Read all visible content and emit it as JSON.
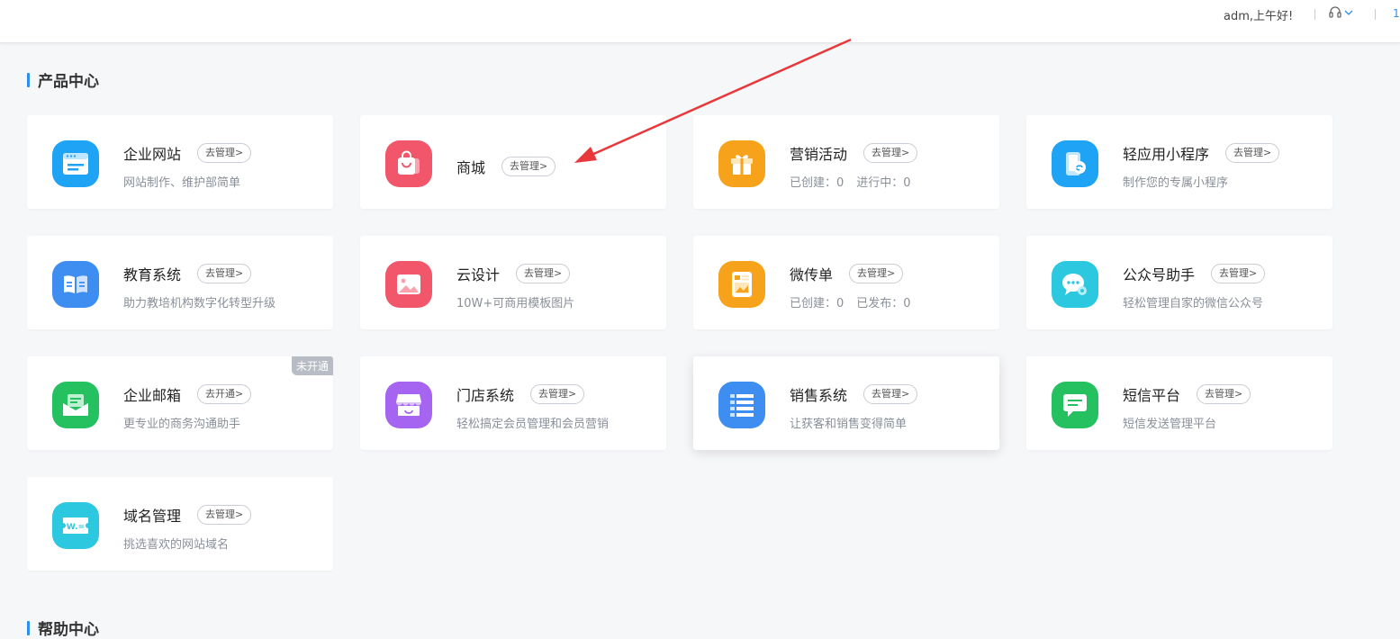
{
  "header": {
    "greeting": "adm,上午好!",
    "service_icon": "headset-icon",
    "dropdown_icon": "chevron-down-icon",
    "edge_text": "1"
  },
  "product_center": {
    "title": "产品中心",
    "manage_label": "去管理>",
    "cards": [
      {
        "name": "企业网站",
        "desc": "网站制作、维护部简单",
        "icon": "website-icon",
        "color": "#1fa3f5",
        "action": "去管理>"
      },
      {
        "name": "商城",
        "desc": "",
        "icon": "shopping-bag-icon",
        "color": "#f2566b",
        "action": "去管理>"
      },
      {
        "name": "营销活动",
        "stat1": "已创建：0",
        "stat2": "进行中：0",
        "icon": "gift-icon",
        "color": "#f7a21b",
        "action": "去管理>"
      },
      {
        "name": "轻应用小程序",
        "desc": "制作您的专属小程序",
        "icon": "mini-program-icon",
        "color": "#1fa3f5",
        "action": "去管理>"
      },
      {
        "name": "教育系统",
        "desc": "助力教培机构数字化转型升级",
        "icon": "book-icon",
        "color": "#3d8ef0",
        "action": "去管理>"
      },
      {
        "name": "云设计",
        "desc": "10W+可商用模板图片",
        "icon": "image-icon",
        "color": "#f2566b",
        "action": "去管理>"
      },
      {
        "name": "微传单",
        "stat1": "已创建：0",
        "stat2": "已发布：0",
        "icon": "flyer-icon",
        "color": "#f7a21b",
        "action": "去管理>"
      },
      {
        "name": "公众号助手",
        "desc": "轻松管理自家的微信公众号",
        "icon": "chat-gear-icon",
        "color": "#2cc8e0",
        "action": "去管理>"
      },
      {
        "name": "企业邮箱",
        "desc": "更专业的商务沟通助手",
        "icon": "mail-icon",
        "color": "#25c160",
        "action": "去开通>",
        "badge": "未开通"
      },
      {
        "name": "门店系统",
        "desc": "轻松搞定会员管理和会员营销",
        "icon": "store-icon",
        "color": "#a565f0",
        "action": "去管理>"
      },
      {
        "name": "销售系统",
        "desc": "让获客和销售变得简单",
        "icon": "list-icon",
        "color": "#3d8ef0",
        "action": "去管理>"
      },
      {
        "name": "短信平台",
        "desc": "短信发送管理平台",
        "icon": "sms-icon",
        "color": "#25c160",
        "action": "去管理>"
      },
      {
        "name": "域名管理",
        "desc": "挑选喜欢的网站域名",
        "icon": "domain-icon",
        "color": "#2cc8e0",
        "action": "去管理>"
      }
    ]
  },
  "help_center": {
    "title": "帮助中心"
  },
  "annotation": {
    "icon": "red-arrow-icon",
    "color": "#e8383b"
  }
}
